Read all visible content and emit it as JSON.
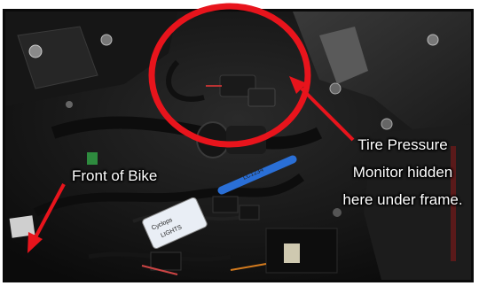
{
  "annotations": {
    "front_label": "Front of Bike",
    "tpm_line1": "Tire Pressure",
    "tpm_line2": "Monitor hidden",
    "tpm_line3": "here under frame."
  },
  "colors": {
    "highlight_circle": "#e8141c",
    "arrow": "#e8141c",
    "label_text": "#ffffff",
    "border": "#0a0a0a"
  },
  "photo": {
    "module_brand": "Cyclops",
    "module_text": "LIGHTS"
  }
}
